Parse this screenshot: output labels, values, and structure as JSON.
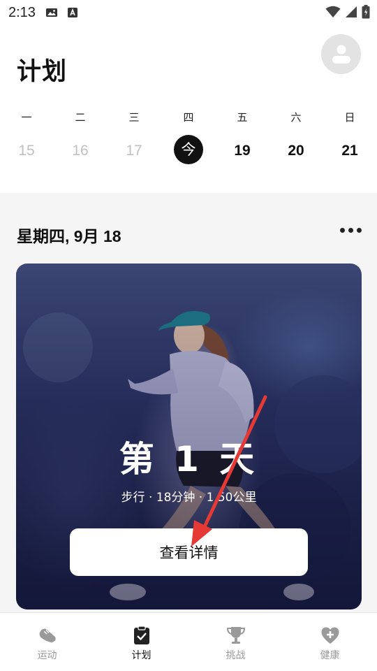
{
  "status_bar": {
    "time": "2:13"
  },
  "header": {
    "title": "计划"
  },
  "week": {
    "days": [
      {
        "name": "一",
        "number": "15",
        "state": "past"
      },
      {
        "name": "二",
        "number": "16",
        "state": "past"
      },
      {
        "name": "三",
        "number": "17",
        "state": "past"
      },
      {
        "name": "四",
        "number": "今",
        "state": "today"
      },
      {
        "name": "五",
        "number": "19",
        "state": "future"
      },
      {
        "name": "六",
        "number": "20",
        "state": "future"
      },
      {
        "name": "日",
        "number": "21",
        "state": "future"
      }
    ]
  },
  "plan": {
    "date_heading": "星期四, 9月 18",
    "card": {
      "title": "第 1 天",
      "subtitle": "步行 · 18分钟 · 1.50公里",
      "button_label": "查看详情"
    }
  },
  "bottom_nav": {
    "items": [
      {
        "label": "运动",
        "icon": "shoe-icon",
        "active": false
      },
      {
        "label": "计划",
        "icon": "clipboard-check-icon",
        "active": true
      },
      {
        "label": "挑战",
        "icon": "trophy-icon",
        "active": false
      },
      {
        "label": "健康",
        "icon": "heart-plus-icon",
        "active": false
      }
    ]
  },
  "colors": {
    "accent": "#111111",
    "annotation_arrow": "#e53935",
    "inactive": "#9a9a9a"
  }
}
